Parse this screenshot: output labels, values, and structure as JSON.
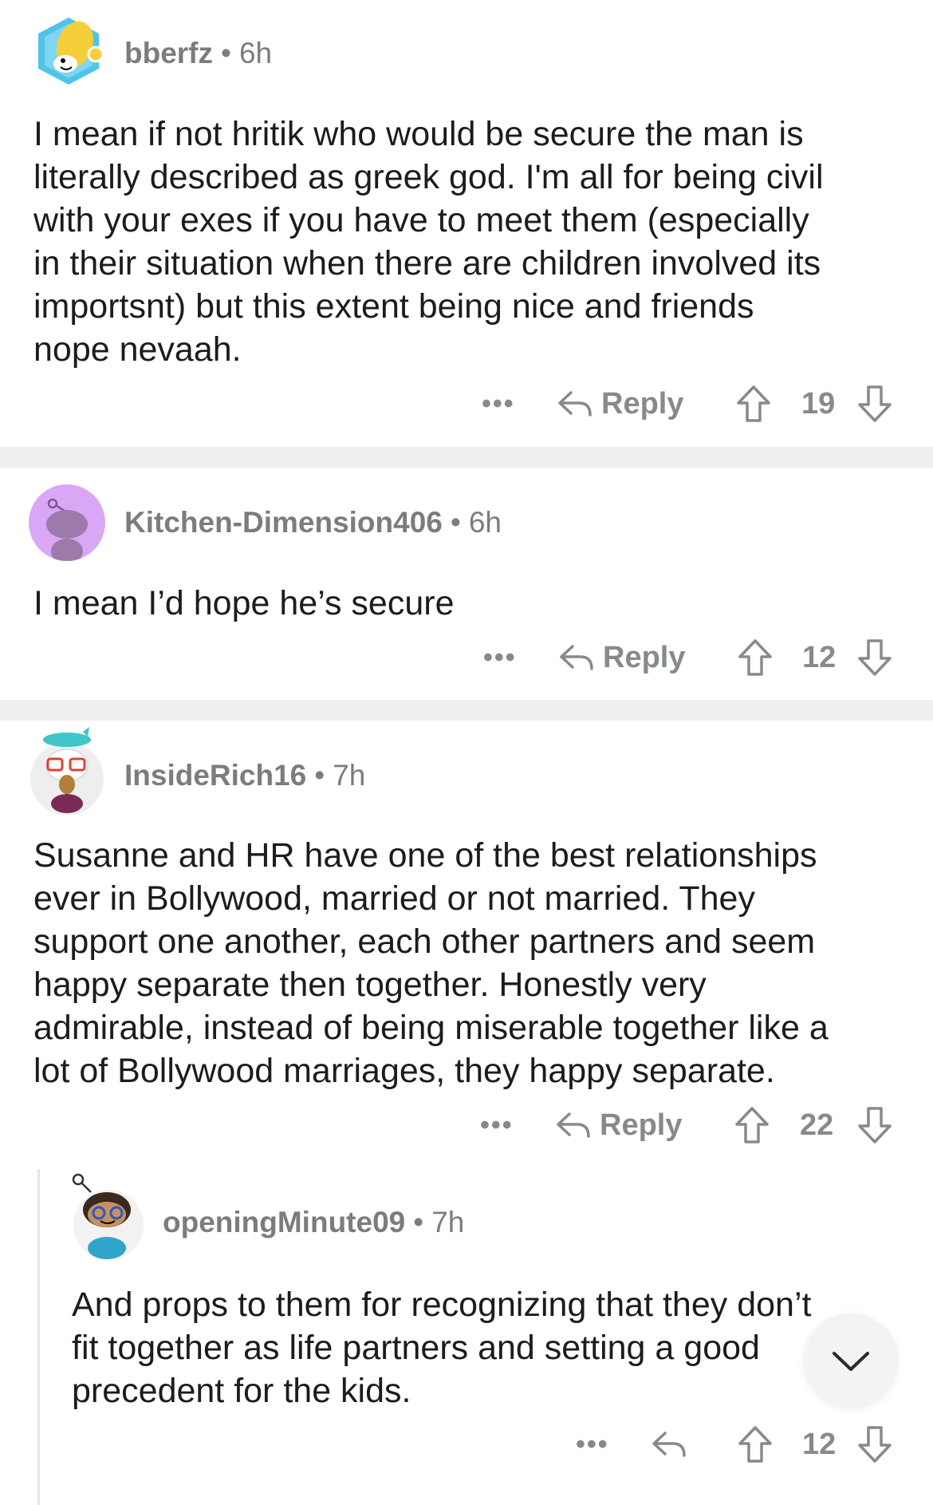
{
  "comments": [
    {
      "username": "bberfz",
      "time": "6h",
      "body_lines": [
        "I mean if not hritik who would be secure the man is",
        "literally described as greek god. I'm all for being civil",
        "with your exes if you have to meet them (especially",
        "in their situation when there are children involved its",
        "importsnt) but this extent being nice and friends",
        "nope nevaah."
      ],
      "more": "•••",
      "reply_label": "Reply",
      "score": "19"
    },
    {
      "username": "Kitchen-Dimension406",
      "time": "6h",
      "body_lines": [
        "I mean I’d hope he’s secure"
      ],
      "more": "•••",
      "reply_label": "Reply",
      "score": "12"
    },
    {
      "username": "InsideRich16",
      "time": "7h",
      "body_lines": [
        "Susanne and HR have one of the best relationships",
        "ever in Bollywood, married or not married. They",
        "support one another, each other partners and seem",
        "happy separate then together. Honestly very",
        "admirable, instead of being miserable together like a",
        "lot of Bollywood marriages, they happy separate."
      ],
      "more": "•••",
      "reply_label": "Reply",
      "score": "22"
    },
    {
      "username": "openingMinute09",
      "time": "7h",
      "body_lines": [
        "And props to them for recognizing that they don’t",
        "fit together as life partners and setting a good",
        "precedent for the kids."
      ],
      "more": "•••",
      "score": "12"
    }
  ],
  "separator": "•",
  "icons": {
    "upvote": "upvote-arrow-icon",
    "downvote": "downvote-arrow-icon",
    "reply": "reply-arrow-icon",
    "scroll": "chevron-down-icon"
  },
  "colors": {
    "text": "#1c1c1c",
    "meta": "#7c7c7c",
    "action": "#878a8c",
    "divider": "#edeff1",
    "avatar_lavender": "#d9a7f5"
  }
}
